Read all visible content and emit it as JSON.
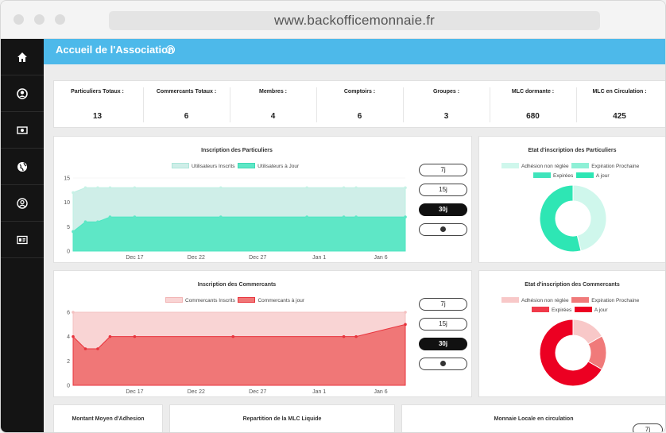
{
  "browser": {
    "url": "www.backofficemonnaie.fr"
  },
  "sidebar": {
    "items": [
      {
        "icon": "home-icon"
      },
      {
        "icon": "user-icon"
      },
      {
        "icon": "money-icon"
      },
      {
        "icon": "globe-icon"
      },
      {
        "icon": "account-icon"
      },
      {
        "icon": "id-card-icon"
      }
    ]
  },
  "header": {
    "title": "Accueil de l'Association",
    "help": "?"
  },
  "stats": [
    {
      "label": "Particuliers Totaux :",
      "value": "13"
    },
    {
      "label": "Commercants Totaux :",
      "value": "6"
    },
    {
      "label": "Membres :",
      "value": "4"
    },
    {
      "label": "Comptoirs :",
      "value": "6"
    },
    {
      "label": "Groupes :",
      "value": "3"
    },
    {
      "label": "MLC dormante :",
      "value": "680"
    },
    {
      "label": "MLC en Circulation :",
      "value": "425"
    }
  ],
  "range_buttons": {
    "b7": "7j",
    "b15": "15j",
    "b30": "30j"
  },
  "chart_data": [
    {
      "type": "area",
      "title": "Inscription des Particuliers",
      "x_ticks": [
        "Dec 17",
        "Dec 22",
        "Dec 27",
        "Jan 1",
        "Jan 6"
      ],
      "y_ticks": [
        "0",
        "5",
        "10",
        "15"
      ],
      "ylim": [
        0,
        15
      ],
      "series": [
        {
          "name": "Utilisateurs Inscrits",
          "color": "#cfeee8",
          "x": [
            0,
            1,
            2,
            3,
            5,
            12,
            19,
            22,
            23,
            27
          ],
          "values": [
            12,
            13,
            13,
            13,
            13,
            13,
            13,
            13,
            13,
            13
          ]
        },
        {
          "name": "Utilisateurs à Jour",
          "color": "#5ee7c6",
          "x": [
            0,
            1,
            2,
            3,
            5,
            12,
            19,
            22,
            23,
            27
          ],
          "values": [
            4,
            6,
            6,
            7,
            7,
            7,
            7,
            7,
            7,
            7
          ]
        }
      ]
    },
    {
      "type": "area",
      "title": "Inscription des Commercants",
      "x_ticks": [
        "Dec 17",
        "Dec 22",
        "Dec 27",
        "Jan 1",
        "Jan 6"
      ],
      "y_ticks": [
        "0",
        "2",
        "4",
        "6"
      ],
      "ylim": [
        0,
        6
      ],
      "series": [
        {
          "name": "Commercants Inscrits",
          "color": "#f9d4d4",
          "x": [
            0,
            27
          ],
          "values": [
            6,
            6
          ]
        },
        {
          "name": "Commercants à jour",
          "color": "#f07777",
          "x": [
            0,
            1,
            2,
            3,
            5,
            13,
            22,
            23,
            27
          ],
          "values": [
            4,
            3,
            3,
            4,
            4,
            4,
            4,
            4,
            5
          ]
        }
      ]
    },
    {
      "type": "pie",
      "title": "Etat d'inscription des Particuliers",
      "labels": [
        "Adhésion non réglée",
        "Expiration Prochaine",
        "Expirées",
        "A jour"
      ],
      "colors": [
        "#cff7ec",
        "#8ef0d6",
        "#3fe4bb",
        "#2ee6b4"
      ],
      "values": [
        6,
        0,
        0,
        7
      ]
    },
    {
      "type": "pie",
      "title": "Etat d'inscription des Commercants",
      "labels": [
        "Adhésion non réglée",
        "Expiration Prochaine",
        "Expirées",
        "A jour"
      ],
      "colors": [
        "#f8c8c8",
        "#f07a7a",
        "#f03a4a",
        "#ec0022"
      ],
      "values": [
        1,
        1,
        0,
        4
      ]
    }
  ],
  "bottom": {
    "card1_title": "Montant Moyen d'Adhesion",
    "card2_title": "Repartition de la MLC Liquide",
    "card3_title": "Monnaie Locale en circulation",
    "card3_button": "7j"
  }
}
